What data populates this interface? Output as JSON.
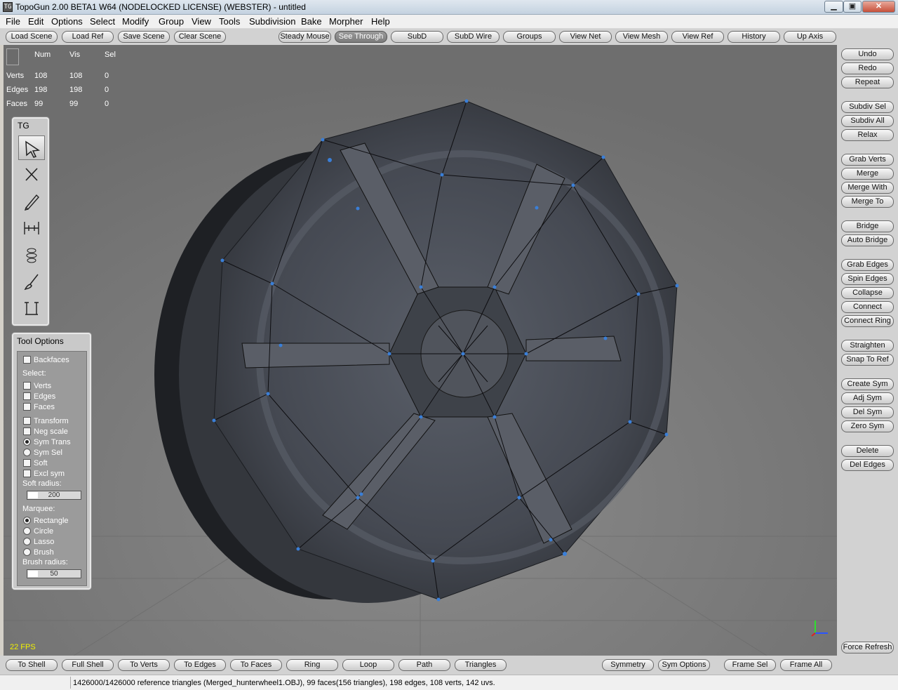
{
  "window": {
    "title": "TopoGun 2.00 BETA1 W64  (NODELOCKED LICENSE) (WEBSTER) - untitled",
    "app_icon_text": "TG",
    "minimize_glyph": "▁",
    "maximize_glyph": "▣",
    "close_glyph": "✕"
  },
  "menu": [
    "File",
    "Edit",
    "Options",
    "Select",
    "Modify",
    "Group",
    "View",
    "Tools",
    "Subdivision",
    "Bake",
    "Morpher",
    "Help"
  ],
  "toolbar_top": {
    "left": [
      "Load Scene",
      "Load Ref",
      "Save Scene",
      "Clear Scene"
    ],
    "right": [
      "Steady Mouse",
      "See Through",
      "SubD",
      "SubD Wire",
      "Groups",
      "View Net",
      "View Mesh",
      "View Ref",
      "History",
      "Up Axis"
    ],
    "active": "See Through"
  },
  "stats": {
    "headers": [
      "Num",
      "Vis",
      "Sel"
    ],
    "rows": [
      {
        "label": "Verts",
        "num": "108",
        "vis": "108",
        "sel": "0"
      },
      {
        "label": "Edges",
        "num": "198",
        "vis": "198",
        "sel": "0"
      },
      {
        "label": "Faces",
        "num": "99",
        "vis": "99",
        "sel": "0"
      }
    ]
  },
  "tg_panel": {
    "label": "TG",
    "tools": [
      "select-tool-icon",
      "cut-tool-icon",
      "draw-tool-icon",
      "bridge-tool-icon",
      "tubes-tool-icon",
      "brush-tool-icon",
      "extrude-tool-icon"
    ],
    "active_tool": "select-tool-icon"
  },
  "tool_options": {
    "title": "Tool Options",
    "backfaces": "Backfaces",
    "select_header": "Select:",
    "select_items": [
      "Verts",
      "Edges",
      "Faces"
    ],
    "transform_items": [
      {
        "label": "Transform",
        "kind": "check",
        "checked": false
      },
      {
        "label": "Neg scale",
        "kind": "check",
        "checked": false
      },
      {
        "label": "Sym Trans",
        "kind": "radio",
        "checked": true
      },
      {
        "label": "Sym Sel",
        "kind": "radio",
        "checked": false
      },
      {
        "label": "Soft",
        "kind": "check",
        "checked": false
      },
      {
        "label": "Excl sym",
        "kind": "check",
        "checked": false
      }
    ],
    "soft_radius_label": "Soft radius:",
    "soft_radius_value": "200",
    "marquee_header": "Marquee:",
    "marquee_items": [
      {
        "label": "Rectangle",
        "checked": true
      },
      {
        "label": "Circle",
        "checked": false
      },
      {
        "label": "Lasso",
        "checked": false
      },
      {
        "label": "Brush",
        "checked": false
      }
    ],
    "brush_radius_label": "Brush radius:",
    "brush_radius_value": "50"
  },
  "right_buttons": [
    [
      "Undo",
      "Redo",
      "Repeat"
    ],
    [
      "Subdiv Sel",
      "Subdiv All",
      "Relax"
    ],
    [
      "Grab Verts",
      "Merge",
      "Merge With",
      "Merge To"
    ],
    [
      "Bridge",
      "Auto Bridge"
    ],
    [
      "Grab Edges",
      "Spin Edges",
      "Collapse",
      "Connect",
      "Connect Ring"
    ],
    [
      "Straighten",
      "Snap To Ref"
    ],
    [
      "Create Sym",
      "Adj Sym",
      "Del Sym",
      "Zero Sym"
    ],
    [
      "Delete",
      "Del Edges"
    ]
  ],
  "force_refresh": "Force Refresh",
  "bottom_toolbar": {
    "left": [
      "To Shell",
      "Full Shell",
      "To Verts",
      "To Edges",
      "To Faces",
      "Ring",
      "Loop",
      "Path",
      "Triangles"
    ],
    "mid": [
      "Symmetry",
      "Sym Options"
    ],
    "right": [
      "Frame Sel",
      "Frame All"
    ]
  },
  "fps": "22 FPS",
  "status_text": "1426000/1426000 reference triangles (Merged_hunterwheel1.OBJ), 99 faces(156 triangles), 198 edges, 108 verts, 142 uvs.",
  "colors": {
    "viewport_bg": "#7c7c7c",
    "highlight_value": "#f0f000",
    "vertex": "#3a7fd8",
    "wheel_dark": "#2e3036",
    "wheel_mid": "#474b54"
  }
}
